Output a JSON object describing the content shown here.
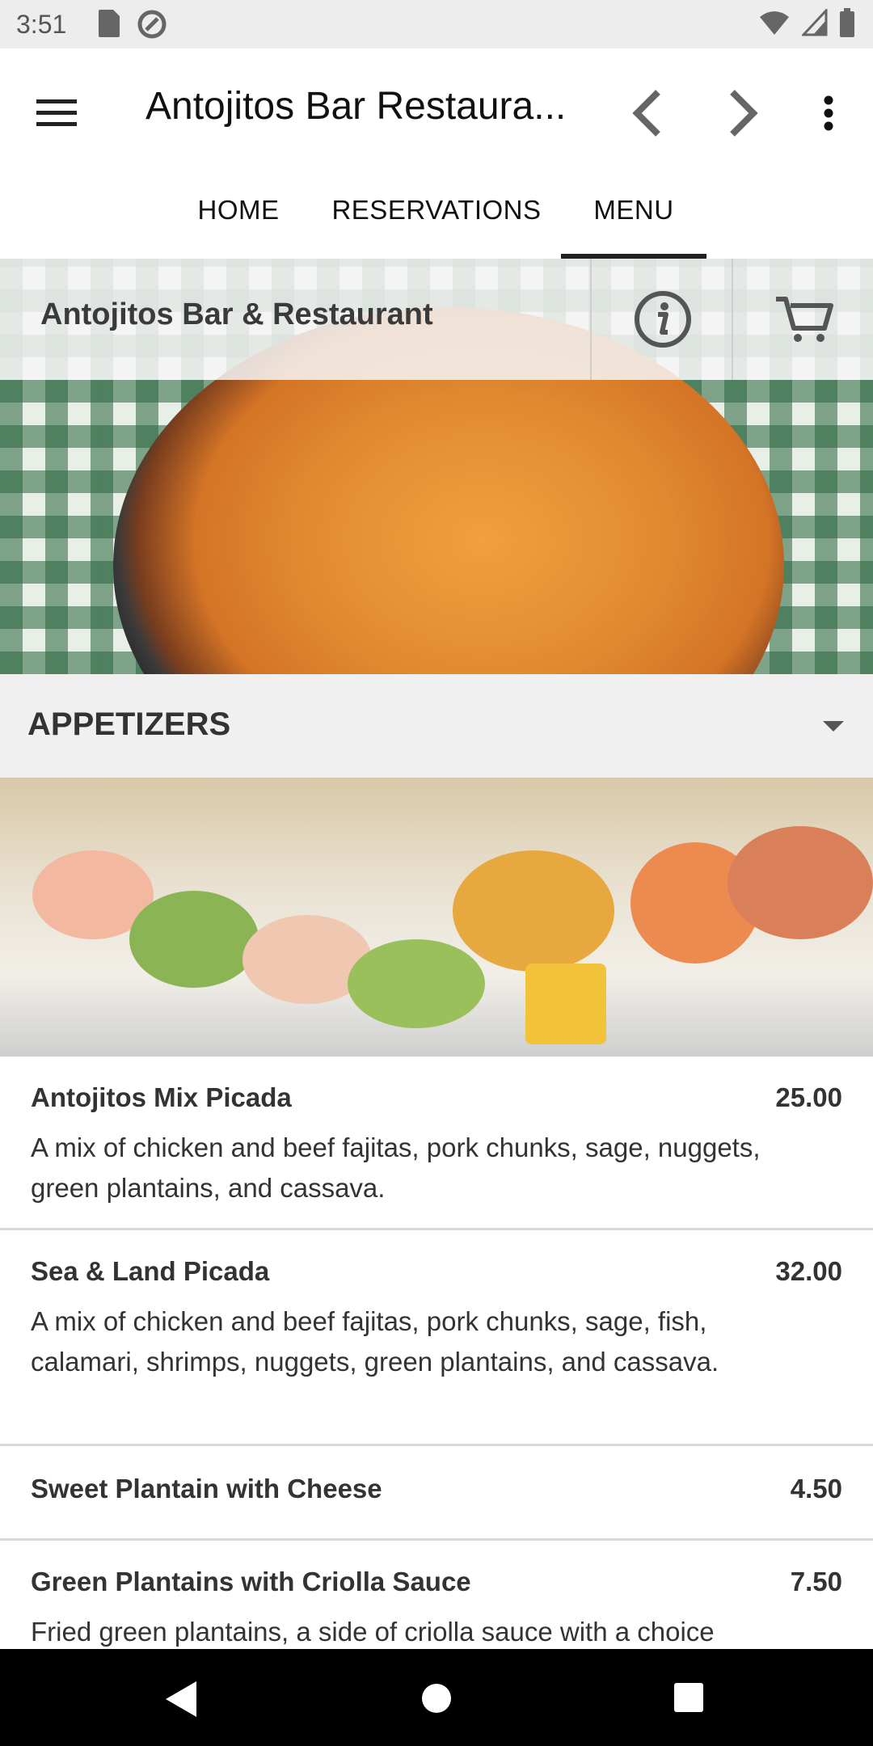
{
  "status_bar": {
    "time": "3:51"
  },
  "app_bar": {
    "title": "Antojitos Bar Restaura..."
  },
  "tabs": [
    {
      "label": "HOME"
    },
    {
      "label": "RESERVATIONS"
    },
    {
      "label": "MENU",
      "selected": true
    }
  ],
  "hero": {
    "restaurant_name": "Antojitos Bar & Restaurant"
  },
  "section": {
    "title": "APPETIZERS"
  },
  "menu_items": [
    {
      "name": "Antojitos Mix Picada",
      "price": "25.00",
      "description": "A mix of chicken and beef fajitas, pork chunks, sage, nuggets, green plantains, and cassava."
    },
    {
      "name": "Sea & Land Picada",
      "price": "32.00",
      "description": "A mix of chicken and beef fajitas, pork chunks, sage, fish, calamari, shrimps, nuggets, green plantains, and cassava."
    },
    {
      "name": "Sweet Plantain with Cheese",
      "price": "4.50",
      "description": ""
    },
    {
      "name": "Green Plantains with Criolla Sauce",
      "price": "7.50",
      "description": "Fried green plantains, a side of criolla sauce with a choice"
    }
  ],
  "colors": {
    "accent": "#202020",
    "section_bg": "#f0f0f0",
    "divider": "#d9d9d9"
  }
}
